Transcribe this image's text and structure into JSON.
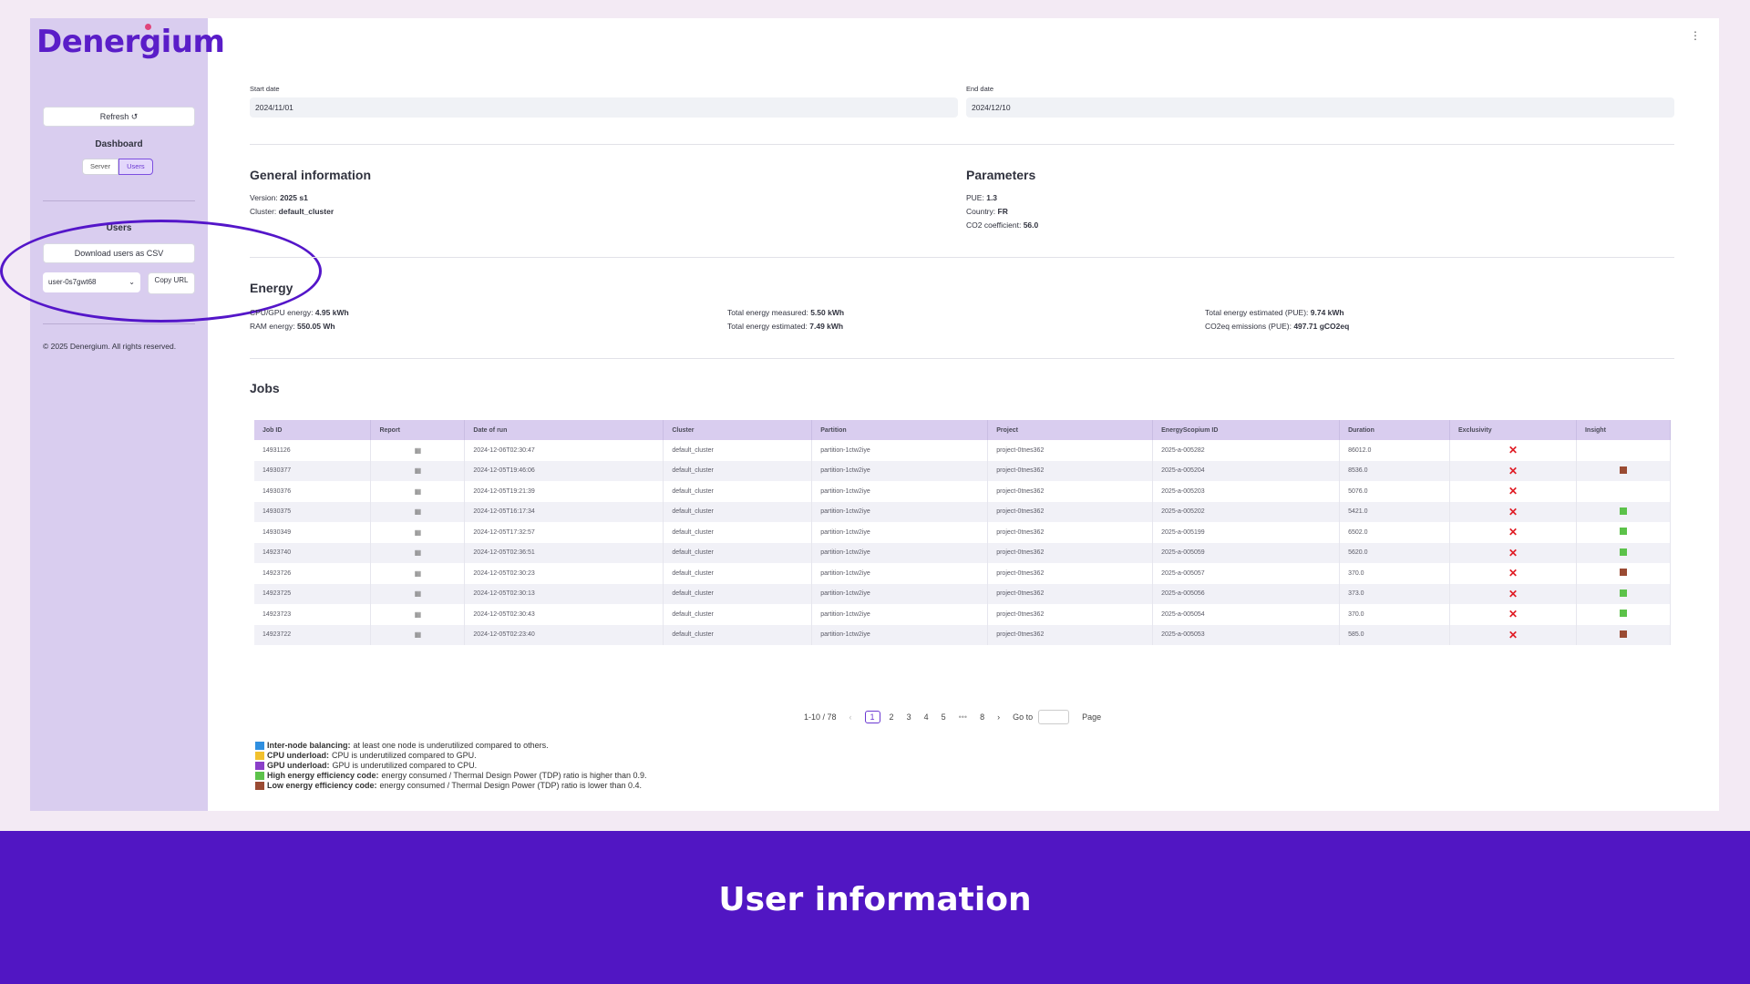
{
  "sidebar": {
    "logo": "Denergium",
    "refresh_label": "Refresh ↺",
    "dashboard_heading": "Dashboard",
    "segments": [
      "Server",
      "Users"
    ],
    "active_segment": "Users",
    "users_heading": "Users",
    "download_csv_label": "Download users as CSV",
    "user_select_value": "user-0s7gwt68",
    "copy_url_label": "Copy URL",
    "copyright": "© 2025 Denergium. All rights reserved."
  },
  "filters": {
    "start_label": "Start date",
    "start_value": "2024/11/01",
    "end_label": "End date",
    "end_value": "2024/12/10"
  },
  "general": {
    "title": "General information",
    "version_label": "Version:",
    "version_value": "2025 s1",
    "cluster_label": "Cluster:",
    "cluster_value": "default_cluster"
  },
  "parameters": {
    "title": "Parameters",
    "pue_label": "PUE:",
    "pue_value": "1.3",
    "country_label": "Country:",
    "country_value": "FR",
    "co2_label": "CO2 coefficient:",
    "co2_value": "56.0"
  },
  "energy": {
    "title": "Energy",
    "cpu_gpu_label": "CPU/GPU energy:",
    "cpu_gpu_value": "4.95 kWh",
    "ram_label": "RAM energy:",
    "ram_value": "550.05 Wh",
    "measured_label": "Total energy measured:",
    "measured_value": "5.50 kWh",
    "estimated_label": "Total energy estimated:",
    "estimated_value": "7.49 kWh",
    "estimated_pue_label": "Total energy estimated (PUE):",
    "estimated_pue_value": "9.74 kWh",
    "co2_label": "CO2eq emissions (PUE):",
    "co2_value": "497.71 gCO2eq"
  },
  "jobs": {
    "title": "Jobs",
    "columns": [
      "Job ID",
      "Report",
      "Date of run",
      "Cluster",
      "Partition",
      "Project",
      "EnergyScopium ID",
      "Duration",
      "Exclusivity",
      "Insight"
    ],
    "rows": [
      {
        "job_id": "14931126",
        "date": "2024-12-06T02:30:47",
        "cluster": "default_cluster",
        "partition": "partition-1ctw2iye",
        "project": "project-0tnes362",
        "es_id": "2025-a-005282",
        "duration": "86012.0",
        "insight": ""
      },
      {
        "job_id": "14930377",
        "date": "2024-12-05T19:46:06",
        "cluster": "default_cluster",
        "partition": "partition-1ctw2iye",
        "project": "project-0tnes362",
        "es_id": "2025-a-005204",
        "duration": "8536.0",
        "insight": "low"
      },
      {
        "job_id": "14930376",
        "date": "2024-12-05T19:21:39",
        "cluster": "default_cluster",
        "partition": "partition-1ctw2iye",
        "project": "project-0tnes362",
        "es_id": "2025-a-005203",
        "duration": "5076.0",
        "insight": ""
      },
      {
        "job_id": "14930375",
        "date": "2024-12-05T16:17:34",
        "cluster": "default_cluster",
        "partition": "partition-1ctw2iye",
        "project": "project-0tnes362",
        "es_id": "2025-a-005202",
        "duration": "5421.0",
        "insight": "high"
      },
      {
        "job_id": "14930349",
        "date": "2024-12-05T17:32:57",
        "cluster": "default_cluster",
        "partition": "partition-1ctw2iye",
        "project": "project-0tnes362",
        "es_id": "2025-a-005199",
        "duration": "6502.0",
        "insight": "high"
      },
      {
        "job_id": "14923740",
        "date": "2024-12-05T02:36:51",
        "cluster": "default_cluster",
        "partition": "partition-1ctw2iye",
        "project": "project-0tnes362",
        "es_id": "2025-a-005059",
        "duration": "5620.0",
        "insight": "high"
      },
      {
        "job_id": "14923726",
        "date": "2024-12-05T02:30:23",
        "cluster": "default_cluster",
        "partition": "partition-1ctw2iye",
        "project": "project-0tnes362",
        "es_id": "2025-a-005057",
        "duration": "370.0",
        "insight": "low"
      },
      {
        "job_id": "14923725",
        "date": "2024-12-05T02:30:13",
        "cluster": "default_cluster",
        "partition": "partition-1ctw2iye",
        "project": "project-0tnes362",
        "es_id": "2025-a-005056",
        "duration": "373.0",
        "insight": "high"
      },
      {
        "job_id": "14923723",
        "date": "2024-12-05T02:30:43",
        "cluster": "default_cluster",
        "partition": "partition-1ctw2iye",
        "project": "project-0tnes362",
        "es_id": "2025-a-005054",
        "duration": "370.0",
        "insight": "high"
      },
      {
        "job_id": "14923722",
        "date": "2024-12-05T02:23:40",
        "cluster": "default_cluster",
        "partition": "partition-1ctw2iye",
        "project": "project-0tnes362",
        "es_id": "2025-a-005053",
        "duration": "585.0",
        "insight": "low"
      }
    ],
    "report_icon": "file-chart-icon",
    "exclusivity_icon": "x-mark-icon",
    "insight_colors": {
      "high": "#5cc24a",
      "low": "#9a4b33"
    }
  },
  "pagination": {
    "range": "1-10 / 78",
    "prev": "‹",
    "pages": [
      "1",
      "2",
      "3",
      "4",
      "5",
      "•••",
      "8"
    ],
    "current": "1",
    "next": "›",
    "goto_label": "Go to",
    "page_label": "Page"
  },
  "legend": [
    {
      "color": "#2f8fe0",
      "name": "Inter-node balancing:",
      "desc": "at least one node is underutilized compared to others."
    },
    {
      "color": "#f2c12e",
      "name": "CPU underload:",
      "desc": "CPU is underutilized compared to GPU."
    },
    {
      "color": "#8a3fc9",
      "name": "GPU underload:",
      "desc": "GPU is underutilized compared to CPU."
    },
    {
      "color": "#5cc24a",
      "name": "High energy efficiency code:",
      "desc": "energy consumed / Thermal Design Power (TDP) ratio is higher than 0.9."
    },
    {
      "color": "#9a4b33",
      "name": "Low energy efficiency code:",
      "desc": "energy consumed / Thermal Design Power (TDP) ratio is lower than 0.4."
    }
  ],
  "banner": {
    "title": "User information"
  },
  "colors": {
    "brand": "#5116c3",
    "sidebar_bg": "#d9cdef",
    "accent": "#6b38d2",
    "error": "#e01b24"
  }
}
